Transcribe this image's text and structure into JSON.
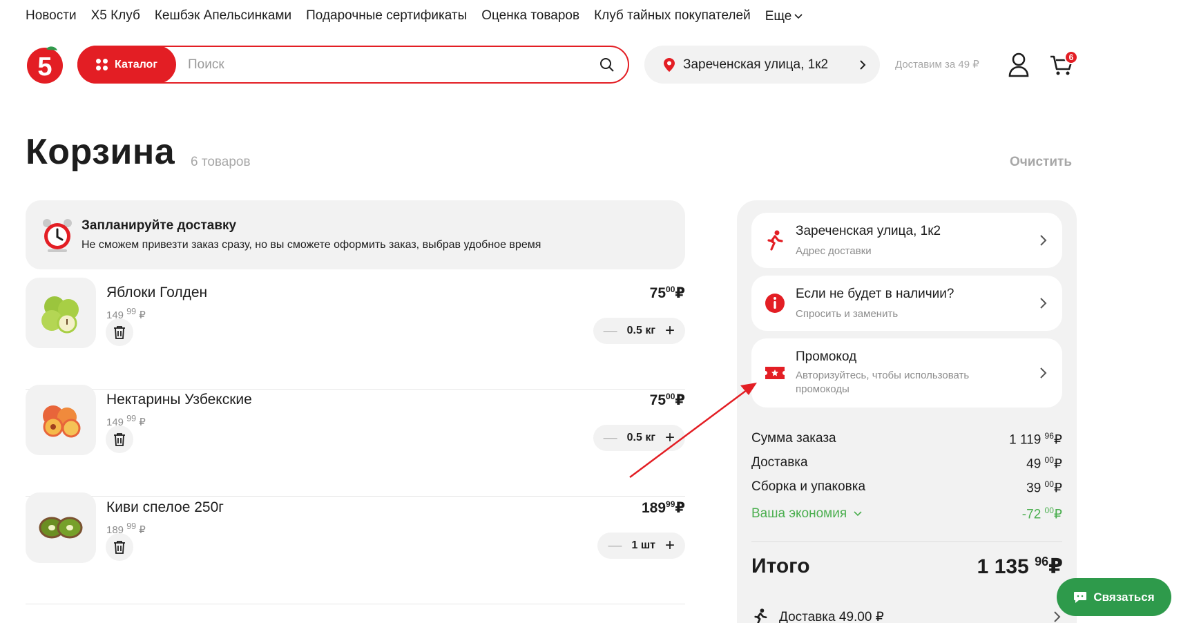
{
  "topnav": [
    "Новости",
    "Х5 Клуб",
    "Кешбэк Апельсинками",
    "Подарочные сертификаты",
    "Оценка товаров",
    "Клуб тайных покупателей"
  ],
  "topnav_more": "Еще",
  "header": {
    "catalog_label": "Каталог",
    "search_placeholder": "Поиск",
    "address": "Зареченская улица, 1к2",
    "delivery_note": "Доставим за 49 ₽",
    "cart_count": "6"
  },
  "page": {
    "title": "Корзина",
    "count": "6 товаров",
    "clear": "Очистить"
  },
  "plan": {
    "title": "Запланируйте доставку",
    "subtitle": "Не сможем привезти заказ сразу, но вы сможете оформить заказ, выбрав удобное время"
  },
  "items": [
    {
      "name": "Яблоки Голден",
      "old_int": "149",
      "old_dec": "99",
      "currency": "₽",
      "price_int": "75",
      "price_dec": "00",
      "qty": "0.5 кг"
    },
    {
      "name": "Нектарины Узбекские",
      "old_int": "149",
      "old_dec": "99",
      "currency": "₽",
      "price_int": "75",
      "price_dec": "00",
      "qty": "0.5 кг"
    },
    {
      "name": "Киви спелое 250г",
      "old_int": "189",
      "old_dec": "99",
      "currency": "₽",
      "price_int": "189",
      "price_dec": "99",
      "qty": "1 шт"
    }
  ],
  "panel": {
    "address_title": "Зареченская улица, 1к2",
    "address_sub": "Адрес доставки",
    "missing_title": "Если не будет в наличии?",
    "missing_sub": "Спросить и заменить",
    "promo_title": "Промокод",
    "promo_sub": "Авторизуйтесь, чтобы использовать промокоды",
    "sum_label": "Сумма заказа",
    "sum_int": "1 119",
    "sum_dec": "96",
    "delivery_label": "Доставка",
    "delivery_int": "49",
    "delivery_dec": "00",
    "assembly_label": "Сборка и упаковка",
    "assembly_int": "39",
    "assembly_dec": "00",
    "economy_label": "Ваша экономия",
    "economy_int": "-72",
    "economy_dec": "00",
    "currency": "₽",
    "total_label": "Итого",
    "total_int": "1 135",
    "total_dec": "96",
    "delivery_row": "Доставка 49.00 ₽"
  },
  "contact_label": "Связаться",
  "colors": {
    "brand": "#e31e24",
    "economy": "#4caf50",
    "contact": "#2e9a4b"
  }
}
